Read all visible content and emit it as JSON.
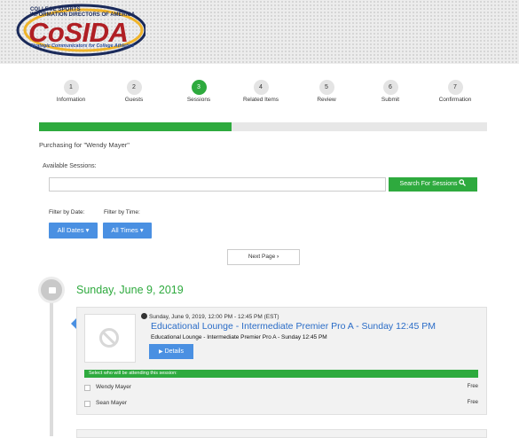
{
  "header": {
    "logo_line1": "COLLEGE SPORTS",
    "logo_line2": "INFORMATION DIRECTORS OF AMERICA",
    "logo_main": "CoSIDA",
    "logo_tagline": "Strategic Communicators for College Athletics"
  },
  "steps": [
    {
      "num": "1",
      "label": "Information"
    },
    {
      "num": "2",
      "label": "Guests"
    },
    {
      "num": "3",
      "label": "Sessions"
    },
    {
      "num": "4",
      "label": "Related Items"
    },
    {
      "num": "5",
      "label": "Review"
    },
    {
      "num": "6",
      "label": "Submit"
    },
    {
      "num": "7",
      "label": "Confirmation"
    }
  ],
  "active_step": "3",
  "progress_fraction": 0.43,
  "purchasing_text": "Purchasing for \"Wendy Mayer\"",
  "sessions": {
    "available_label": "Available Sessions:",
    "search_value": "",
    "search_button": "Search For Sessions"
  },
  "filters": {
    "date_label": "Filter by Date:",
    "time_label": "Filter by Time:",
    "date_button": "All Dates",
    "time_button": "All Times"
  },
  "next_page": "Next Page",
  "day": {
    "heading": "Sunday, June 9, 2019",
    "session": {
      "time": "Sunday, June 9, 2019, 12:00 PM - 12:45 PM (EST)",
      "title": "Educational Lounge - Intermediate Premier Pro A - Sunday 12:45 PM",
      "subtitle": "Educational Lounge - Intermediate Premier Pro A - Sunday 12:45 PM",
      "details_button": "Details",
      "select_text": "Select who will be attending this session:",
      "attendees": [
        {
          "name": "Wendy Mayer",
          "price": "Free"
        },
        {
          "name": "Sean Mayer",
          "price": "Free"
        }
      ]
    }
  },
  "colors": {
    "accent_green": "#2eaa3e",
    "accent_blue": "#4a90e2",
    "link_blue": "#2a6cc7",
    "logo_red": "#b01f24"
  }
}
